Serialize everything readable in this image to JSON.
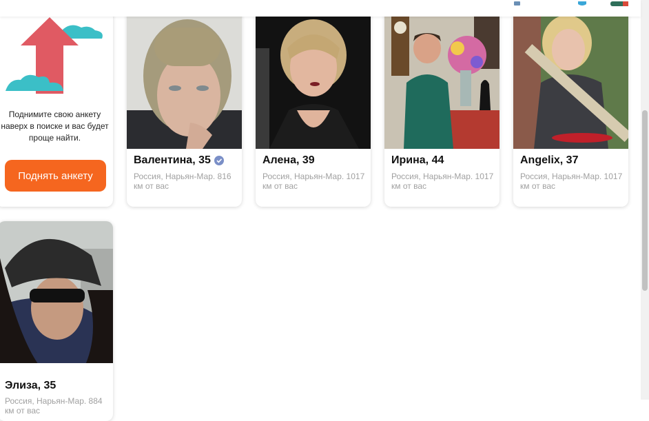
{
  "promo": {
    "text": "Поднимите свою анкету наверх в поиске и вас будет проще найти.",
    "button_label": "Поднять анкету",
    "accent_color": "#f5661f",
    "arrow_color": "#e05a63",
    "cloud_color": "#3bbfc7"
  },
  "profiles": [
    {
      "name": "Валентина, 35",
      "verified": true,
      "location": "Россия, Нарьян-Мар. 816 км от вас",
      "photo": "woman-short-hair-portrait"
    },
    {
      "name": "Алена, 39",
      "verified": false,
      "location": "Россия, Нарьян-Мар. 1017 км от вас",
      "photo": "woman-blonde-bob-dark-background"
    },
    {
      "name": "Ирина, 44",
      "verified": false,
      "location": "Россия, Нарьян-Мар. 1017 км от вас",
      "photo": "woman-green-dress-flowers"
    },
    {
      "name": "Angelix, 37",
      "verified": false,
      "location": "Россия, Нарьян-Мар. 1017 км от вас",
      "photo": "woman-curly-blonde-fence"
    },
    {
      "name": "Элиза, 35",
      "verified": false,
      "location": "Россия, Нарьян-Мар. 884 км от вас",
      "photo": "woman-black-cap-sunglasses"
    }
  ]
}
